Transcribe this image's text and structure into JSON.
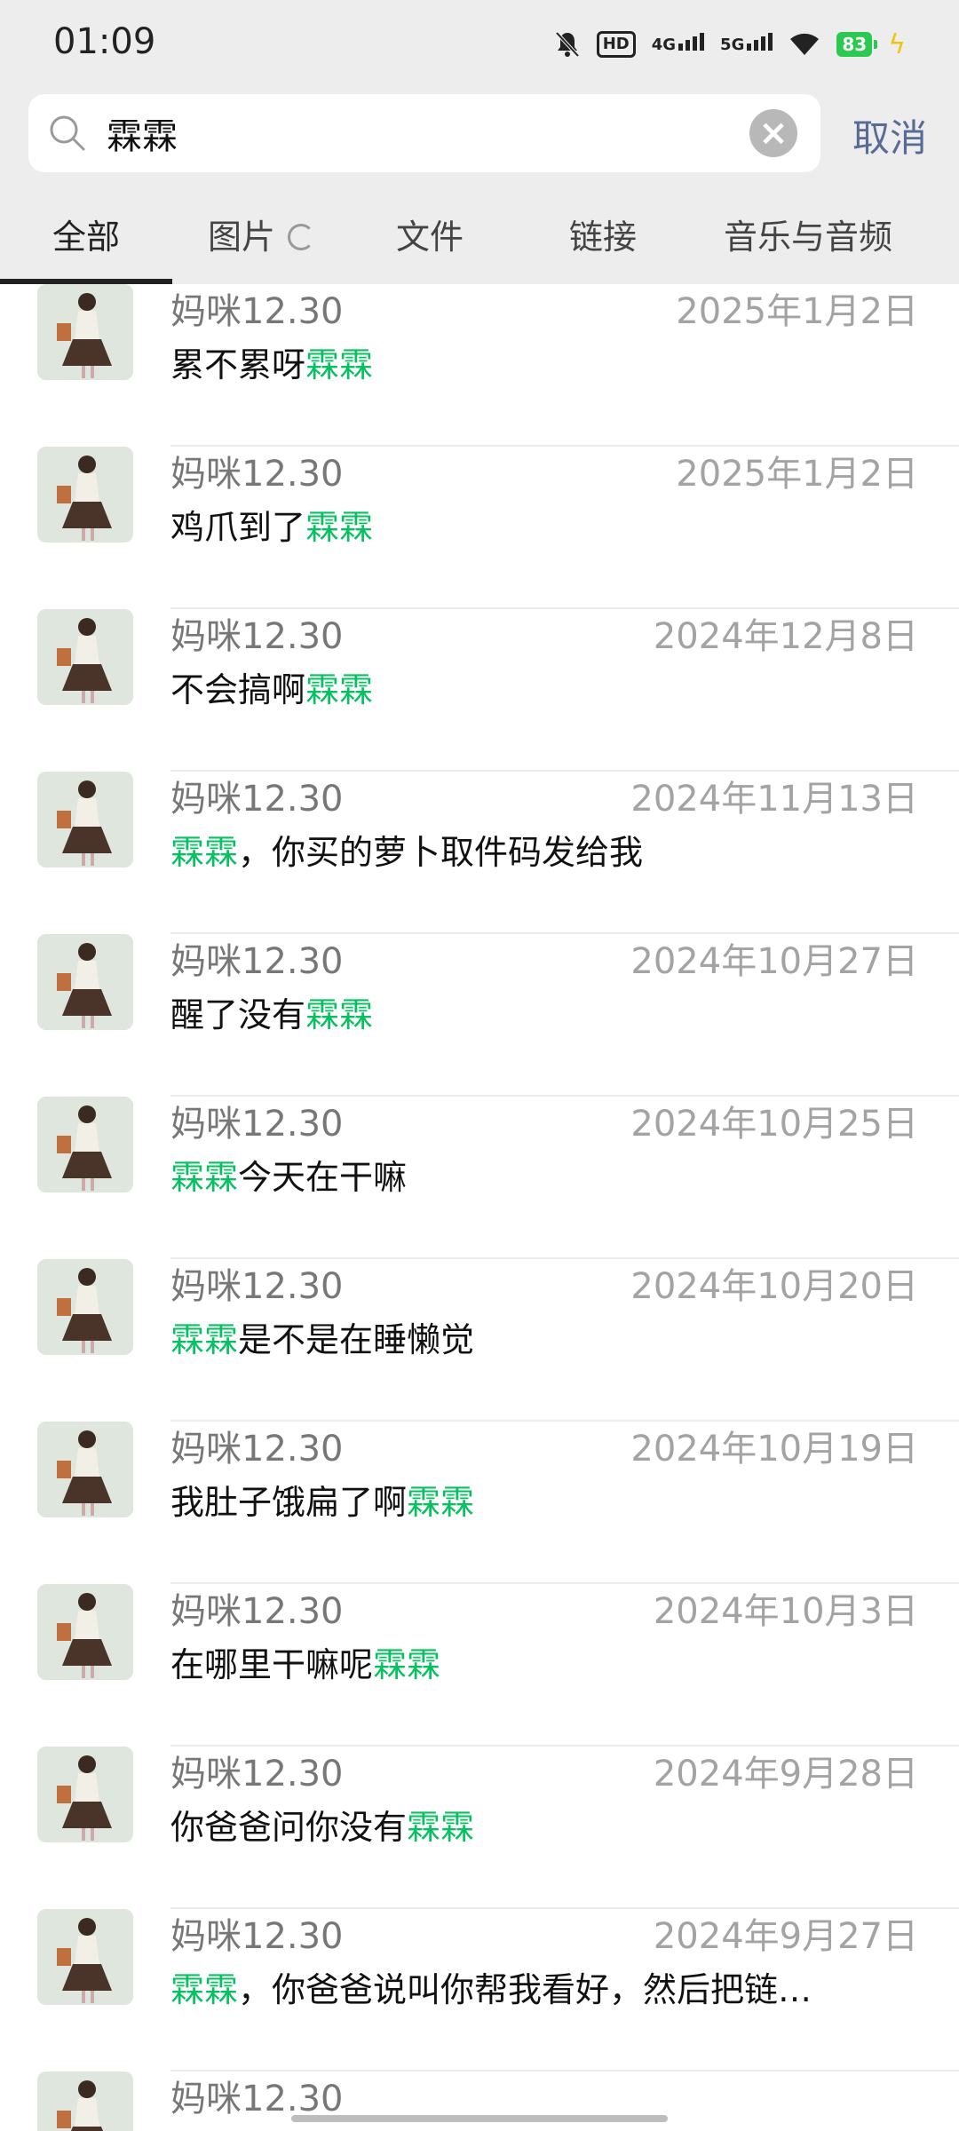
{
  "status_bar": {
    "time": "01:09",
    "hd": "HD",
    "net1": "4G",
    "net2": "5G",
    "battery": "83",
    "icons": [
      "bell-muted-icon",
      "hd-icon",
      "4g-signal-icon",
      "5g-signal-icon",
      "wifi-icon",
      "battery-icon",
      "charging-bolt-icon"
    ]
  },
  "search": {
    "value": "霖霖",
    "placeholder": "",
    "cancel_label": "取消"
  },
  "tabs": [
    {
      "label": "全部",
      "active": true
    },
    {
      "label": "图片",
      "active": false
    },
    {
      "label": "文件",
      "active": false
    },
    {
      "label": "链接",
      "active": false
    },
    {
      "label": "音乐与音频",
      "active": false
    }
  ],
  "colors": {
    "highlight": "#07c160",
    "link_blue": "#576b95",
    "header_bg": "#ededed"
  },
  "results": [
    {
      "name": "妈咪12.30",
      "date": "2025年1月2日",
      "pre": "累不累呀",
      "hl": "霖霖",
      "post": ""
    },
    {
      "name": "妈咪12.30",
      "date": "2025年1月2日",
      "pre": "鸡爪到了",
      "hl": "霖霖",
      "post": ""
    },
    {
      "name": "妈咪12.30",
      "date": "2024年12月8日",
      "pre": "不会搞啊",
      "hl": "霖霖",
      "post": ""
    },
    {
      "name": "妈咪12.30",
      "date": "2024年11月13日",
      "pre": "",
      "hl": "霖霖",
      "post": "，你买的萝卜取件码发给我"
    },
    {
      "name": "妈咪12.30",
      "date": "2024年10月27日",
      "pre": "醒了没有",
      "hl": "霖霖",
      "post": ""
    },
    {
      "name": "妈咪12.30",
      "date": "2024年10月25日",
      "pre": "",
      "hl": "霖霖",
      "post": "今天在干嘛"
    },
    {
      "name": "妈咪12.30",
      "date": "2024年10月20日",
      "pre": "",
      "hl": "霖霖",
      "post": "是不是在睡懒觉"
    },
    {
      "name": "妈咪12.30",
      "date": "2024年10月19日",
      "pre": "我肚子饿扁了啊",
      "hl": "霖霖",
      "post": ""
    },
    {
      "name": "妈咪12.30",
      "date": "2024年10月3日",
      "pre": "在哪里干嘛呢",
      "hl": "霖霖",
      "post": ""
    },
    {
      "name": "妈咪12.30",
      "date": "2024年9月28日",
      "pre": "你爸爸问你没有",
      "hl": "霖霖",
      "post": ""
    },
    {
      "name": "妈咪12.30",
      "date": "2024年9月27日",
      "pre": "",
      "hl": "霖霖",
      "post": "，你爸爸说叫你帮我看好，然后把链…"
    },
    {
      "name": "妈咪12.30",
      "date": "",
      "pre": "",
      "hl": "",
      "post": ""
    }
  ]
}
